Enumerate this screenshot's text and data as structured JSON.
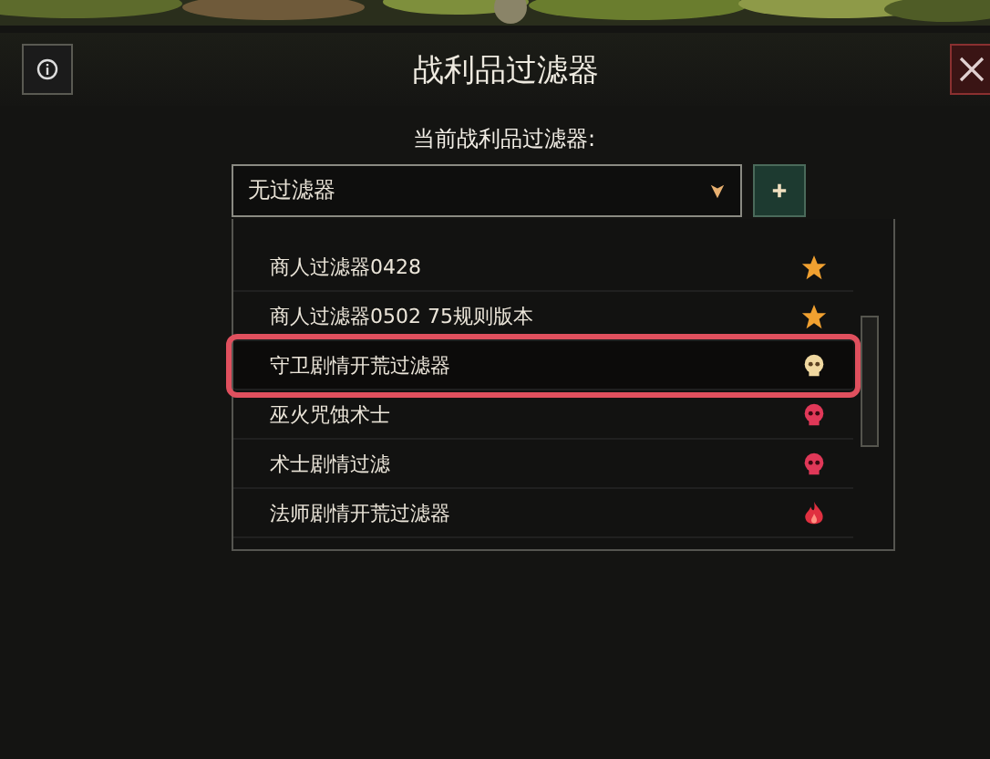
{
  "window": {
    "title": "战利品过滤器"
  },
  "current_filter": {
    "label": "当前战利品过滤器:",
    "value": "无过滤器"
  },
  "filters": [
    {
      "name": "商人过滤器0428",
      "kind": "star",
      "selected": false
    },
    {
      "name": "商人过滤器0502 75规则版本",
      "kind": "star",
      "selected": false
    },
    {
      "name": "守卫剧情开荒过滤器",
      "kind": "pale-skull",
      "selected": true
    },
    {
      "name": "巫火咒蚀术士",
      "kind": "red-skull",
      "selected": false
    },
    {
      "name": "术士剧情过滤",
      "kind": "red-skull",
      "selected": false
    },
    {
      "name": "法师剧情开荒过滤器",
      "kind": "flame",
      "selected": false
    }
  ]
}
